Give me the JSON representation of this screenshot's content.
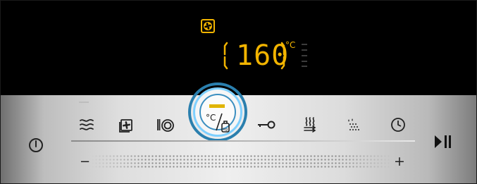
{
  "display": {
    "temperature": "160",
    "temperature_unit": "°C",
    "fan_indicator_icon": "fan-icon",
    "accent_color": "#f2b400"
  },
  "controls": {
    "power_icon": "power-icon",
    "start_stop_icon": "play-pause-icon",
    "slider_minus": "−",
    "slider_plus": "+",
    "programs": [
      {
        "icon": "top-bottom-heat-icon"
      },
      {
        "icon": "hot-air-icon"
      },
      {
        "icon": "plate-warming-icon"
      },
      {
        "icon": "temperature-weight-icon",
        "selected": true
      },
      {
        "icon": "key-lock-icon"
      },
      {
        "icon": "rapid-heat-icon"
      },
      {
        "icon": "steam-cleaning-icon"
      },
      {
        "icon": "timer-icon"
      }
    ],
    "selection_color": "#e0b400",
    "ring_color": "#2a7fae"
  }
}
